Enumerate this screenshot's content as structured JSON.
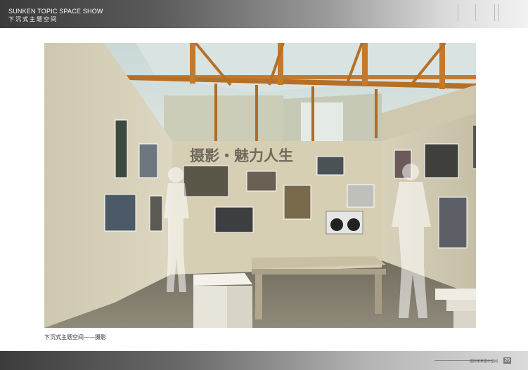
{
  "header": {
    "title": "SUNKEN TOPIC SPACE SHOW",
    "subtitle": "下沉式主题空间"
  },
  "photo": {
    "wall_slogan": "摄影・魅力人生"
  },
  "caption": "下沉式主题空间——摄影",
  "footer": {
    "note": "国际某某展示空间",
    "page_number": "26"
  }
}
